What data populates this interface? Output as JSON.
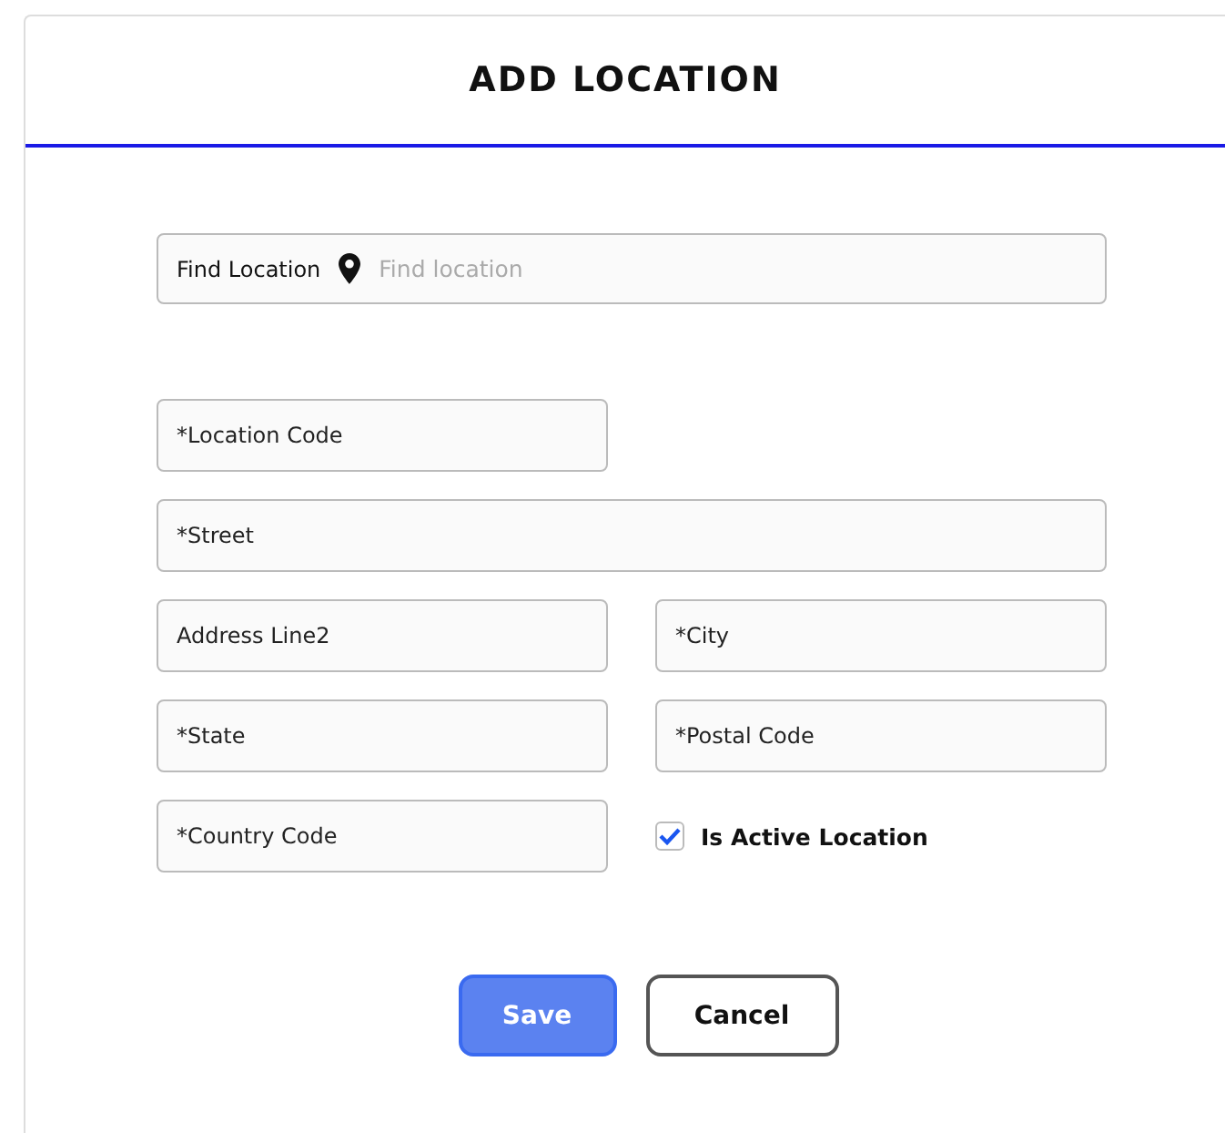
{
  "dialog": {
    "title": "ADD LOCATION"
  },
  "find": {
    "label": "Find Location",
    "placeholder": "Find location"
  },
  "fields": [
    {
      "kind": "text",
      "placeholder": "*Location Code",
      "wide": false
    },
    {
      "kind": "text",
      "placeholder": "*Street",
      "wide": true
    },
    {
      "kind": "text",
      "placeholder": "Address Line2",
      "wide": false
    },
    {
      "kind": "text",
      "placeholder": "*City",
      "wide": false
    },
    {
      "kind": "text",
      "placeholder": "*State",
      "wide": false
    },
    {
      "kind": "text",
      "placeholder": "*Postal Code",
      "wide": false
    },
    {
      "kind": "text",
      "placeholder": "*Country Code",
      "wide": false
    },
    {
      "kind": "checkbox",
      "label": "Is Active Location",
      "checked": true
    }
  ],
  "buttons": [
    {
      "kind": "primary",
      "label": "Save"
    },
    {
      "kind": "secondary",
      "label": "Cancel"
    }
  ]
}
